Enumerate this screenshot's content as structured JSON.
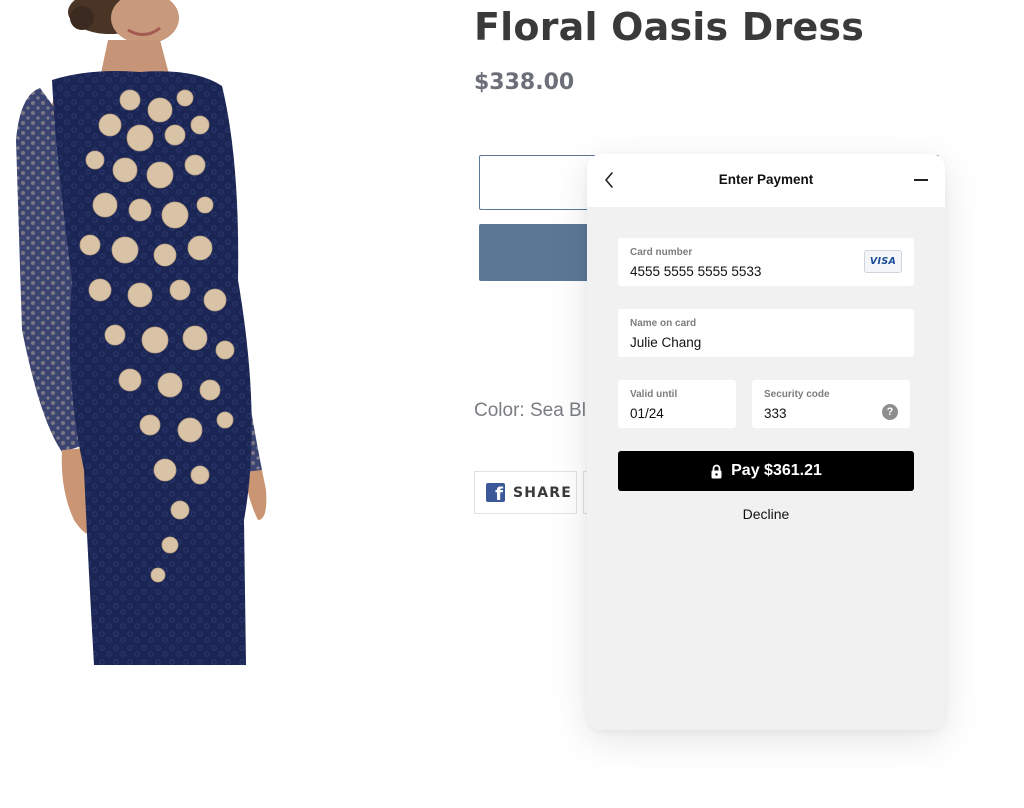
{
  "product": {
    "title": "Floral Oasis Dress",
    "price": "$338.00",
    "color_label": "Color: Sea Bl",
    "share_label": "SHARE",
    "accent_color": "#5a7895"
  },
  "payment_modal": {
    "title": "Enter Payment",
    "card_number": {
      "label": "Card number",
      "value": "4555 5555 5555 5533",
      "brand": "VISA"
    },
    "name_on_card": {
      "label": "Name on card",
      "value": "Julie Chang"
    },
    "valid_until": {
      "label": "Valid until",
      "value": "01/24"
    },
    "security_code": {
      "label": "Security code",
      "value": "333",
      "help": "?"
    },
    "pay_label": "Pay $361.21",
    "decline_label": "Decline",
    "icons": [
      "back-arrow-icon",
      "minimize-icon",
      "lock-icon",
      "help-icon",
      "visa-icon",
      "facebook-icon"
    ]
  }
}
